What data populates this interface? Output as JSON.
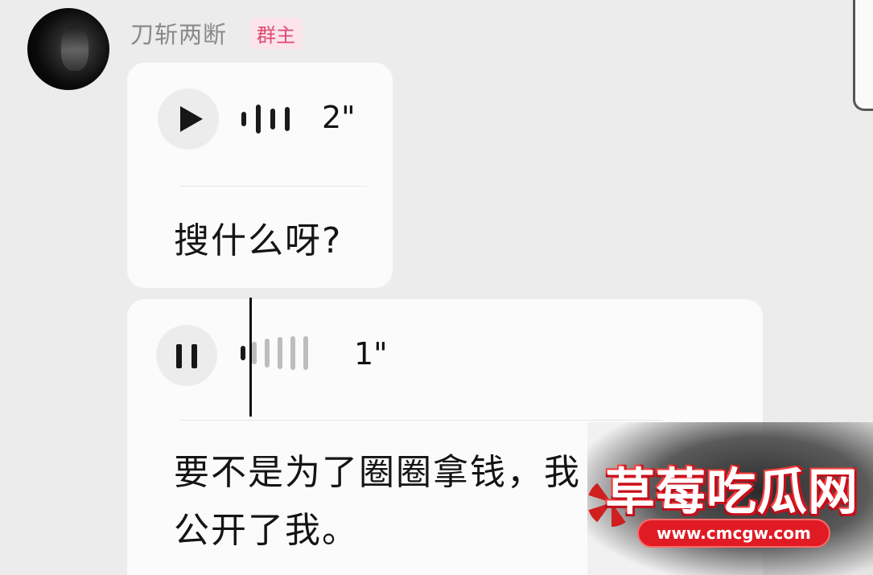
{
  "sender": {
    "name": "刀斩两断",
    "role_badge": "群主"
  },
  "messages": [
    {
      "type": "voice",
      "state": "paused",
      "duration": "2\"",
      "transcript": "搜什么呀?"
    },
    {
      "type": "voice",
      "state": "playing",
      "duration": "1\"",
      "transcript_lines": [
        "要不是为了圈圈拿钱，我",
        "公开了我。"
      ]
    }
  ],
  "watermark": {
    "title": "草莓吃瓜网",
    "url": "www.cmcgw.com"
  },
  "colors": {
    "background": "#ececed",
    "bubble": "#fbfbfb",
    "role_badge_text": "#e14a72",
    "role_badge_bg": "#fbe4ea"
  }
}
